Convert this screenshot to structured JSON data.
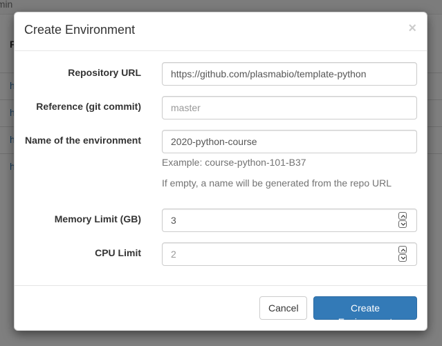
{
  "background": {
    "topbar_text": "dmin",
    "table_header": "F",
    "row_links": [
      "h",
      "h",
      "h",
      "h"
    ]
  },
  "modal": {
    "title": "Create Environment",
    "close_symbol": "×",
    "fields": {
      "repo_url": {
        "label": "Repository URL",
        "value": "https://github.com/plasmabio/template-python"
      },
      "reference": {
        "label": "Reference (git commit)",
        "placeholder": "master"
      },
      "name": {
        "label": "Name of the environment",
        "value": "2020-python-course",
        "help_example": "Example: course-python-101-B37",
        "help_empty": "If empty, a name will be generated from the repo URL"
      },
      "memory": {
        "label": "Memory Limit (GB)",
        "value": "3"
      },
      "cpu": {
        "label": "CPU Limit",
        "placeholder": "2"
      }
    },
    "footer": {
      "cancel_label": "Cancel",
      "submit_label": "Create Environment"
    }
  },
  "colors": {
    "primary": "#337ab7",
    "link": "#337ab7",
    "overlay": "rgba(0,0,0,0.5)"
  }
}
